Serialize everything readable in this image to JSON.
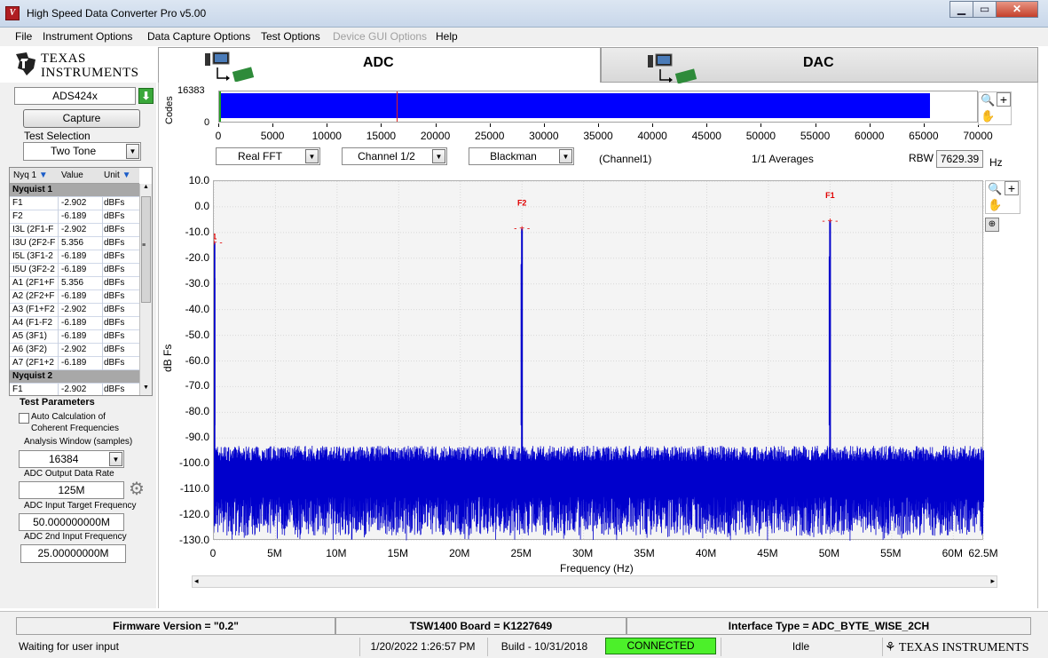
{
  "window": {
    "title": "High Speed Data Converter Pro v5.00",
    "app_icon": "ti-converter-icon"
  },
  "menu": [
    "File",
    "Instrument Options",
    "Data Capture Options",
    "Test Options",
    "Device GUI Options",
    "Help"
  ],
  "brand": {
    "line1": "Texas",
    "line2": "Instruments"
  },
  "tabs": {
    "adc": "ADC",
    "dac": "DAC"
  },
  "device": {
    "name": "ADS424x",
    "capture_label": "Capture",
    "test_selection_label": "Test Selection",
    "test_selection_value": "Two Tone"
  },
  "table": {
    "headers": [
      "Nyq 1",
      "Value",
      "Unit"
    ],
    "rows": [
      {
        "name": "Nyquist 1",
        "value": "",
        "unit": "",
        "section": true
      },
      {
        "name": "F1",
        "value": "-2.902",
        "unit": "dBFs"
      },
      {
        "name": "F2",
        "value": "-6.189",
        "unit": "dBFs"
      },
      {
        "name": "I3L (2F1-F",
        "value": "-2.902",
        "unit": "dBFs"
      },
      {
        "name": "I3U (2F2-F",
        "value": "5.356",
        "unit": "dBFs"
      },
      {
        "name": "I5L (3F1-2",
        "value": "-6.189",
        "unit": "dBFs"
      },
      {
        "name": "I5U (3F2-2",
        "value": "-6.189",
        "unit": "dBFs"
      },
      {
        "name": "A1 (2F1+F",
        "value": "5.356",
        "unit": "dBFs"
      },
      {
        "name": "A2 (2F2+F",
        "value": "-6.189",
        "unit": "dBFs"
      },
      {
        "name": "A3 (F1+F2",
        "value": "-2.902",
        "unit": "dBFs"
      },
      {
        "name": "A4 (F1-F2",
        "value": "-6.189",
        "unit": "dBFs"
      },
      {
        "name": "A5 (3F1)",
        "value": "-6.189",
        "unit": "dBFs"
      },
      {
        "name": "A6 (3F2)",
        "value": "-2.902",
        "unit": "dBFs"
      },
      {
        "name": "A7 (2F1+2",
        "value": "-6.189",
        "unit": "dBFs"
      },
      {
        "name": "Nyquist 2",
        "value": "",
        "unit": "",
        "section": true
      },
      {
        "name": "F1",
        "value": "-2.902",
        "unit": "dBFs"
      }
    ]
  },
  "test_params": {
    "heading": "Test Parameters",
    "auto_calc_label": "Auto Calculation of Coherent Frequencies",
    "analysis_window_label": "Analysis Window (samples)",
    "analysis_window_value": "16384",
    "adc_rate_label": "ADC Output Data Rate",
    "adc_rate_value": "125M",
    "target_freq_label": "ADC Input Target Frequency",
    "target_freq_value": "50.000000000M",
    "second_freq_label": "ADC 2nd Input Frequency",
    "second_freq_value": "25.00000000M"
  },
  "codes_plot": {
    "ylabel": "Codes",
    "y_ticks": [
      "16383",
      "0"
    ],
    "x_ticks": [
      "0",
      "5000",
      "10000",
      "15000",
      "20000",
      "25000",
      "30000",
      "35000",
      "40000",
      "45000",
      "50000",
      "55000",
      "60000",
      "65000",
      "70000"
    ],
    "fill_to_sample": 65536,
    "x_max": 70000,
    "marker_sample": 16384,
    "bar_color": "#0000ff"
  },
  "controls": {
    "fft_type": "Real FFT",
    "channel": "Channel 1/2",
    "window": "Blackman",
    "channel_note": "(Channel1)",
    "averages": "1/1 Averages",
    "rbw_label": "RBW",
    "rbw_value": "7629.39",
    "rbw_unit": "Hz"
  },
  "chart_data": {
    "type": "line",
    "xlabel": "Frequency (Hz)",
    "ylabel": "dB Fs",
    "x_unit": "MHz",
    "xlim": [
      0,
      62.5
    ],
    "ylim": [
      -130,
      10
    ],
    "y_ticks": [
      "10.0",
      "0.0",
      "-10.0",
      "-20.0",
      "-30.0",
      "-40.0",
      "-50.0",
      "-60.0",
      "-70.0",
      "-80.0",
      "-90.0",
      "-100.0",
      "-110.0",
      "-120.0",
      "-130.0"
    ],
    "x_ticks": [
      "0",
      "5M",
      "10M",
      "15M",
      "20M",
      "25M",
      "30M",
      "35M",
      "40M",
      "45M",
      "50M",
      "55M",
      "60M",
      "62.5M"
    ],
    "noise_floor_db": -105,
    "peaks": [
      {
        "x": 0.05,
        "y": -14,
        "label": "1"
      },
      {
        "x": 25.0,
        "y": -8.5,
        "label": "F2"
      },
      {
        "x": 50.0,
        "y": -5.5,
        "label": "F1"
      }
    ],
    "series_color": "#0000cc"
  },
  "status": {
    "firmware": "Firmware Version = \"0.2\"",
    "board": "TSW1400 Board = K1227649",
    "interface": "Interface Type = ADC_BYTE_WISE_2CH",
    "message": "Waiting for user input",
    "datetime": "1/20/2022 1:26:57 PM",
    "build": "Build  - 10/31/2018",
    "connection": "CONNECTED",
    "state": "Idle",
    "brand": "Texas Instruments"
  }
}
